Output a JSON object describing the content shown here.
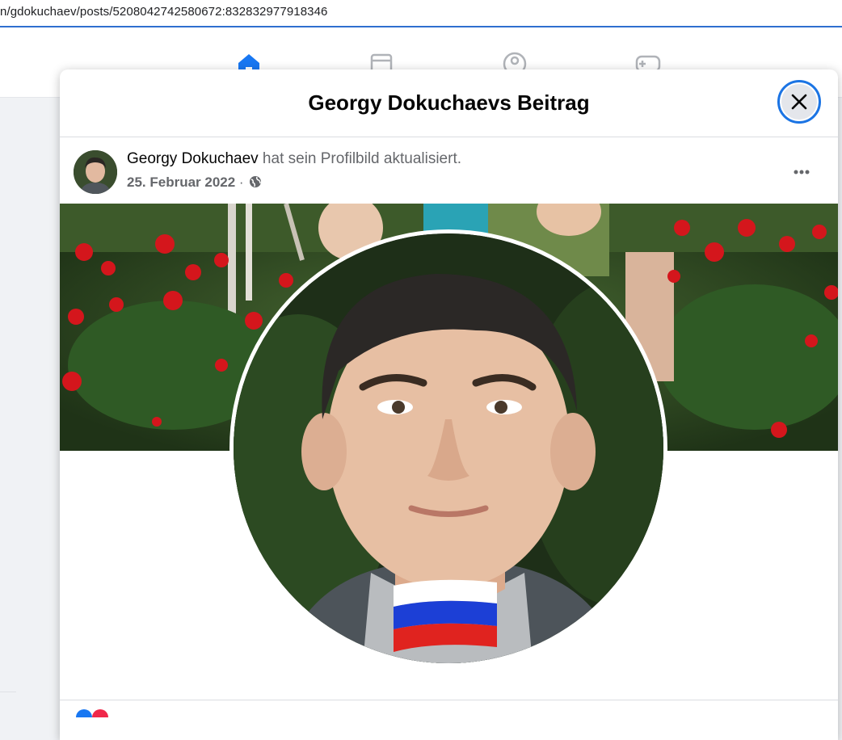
{
  "browser": {
    "url": "n/gdokuchaev/posts/5208042742580672:832832977918346"
  },
  "modal": {
    "title": "Georgy Dokuchaevs Beitrag",
    "close_icon": "close-icon"
  },
  "post": {
    "author": "Georgy Dokuchaev",
    "action": " hat sein Profilbild aktualisiert.",
    "date": "25. Februar 2022",
    "separator": " · ",
    "privacy_icon": "globe-icon",
    "more_icon": "more-horizontal-icon"
  },
  "colors": {
    "accent": "#1b74e4",
    "text_primary": "#050505",
    "text_secondary": "#65676b",
    "flag_white": "#ffffff",
    "flag_blue": "#1c3fd6",
    "flag_red": "#e0231f"
  }
}
